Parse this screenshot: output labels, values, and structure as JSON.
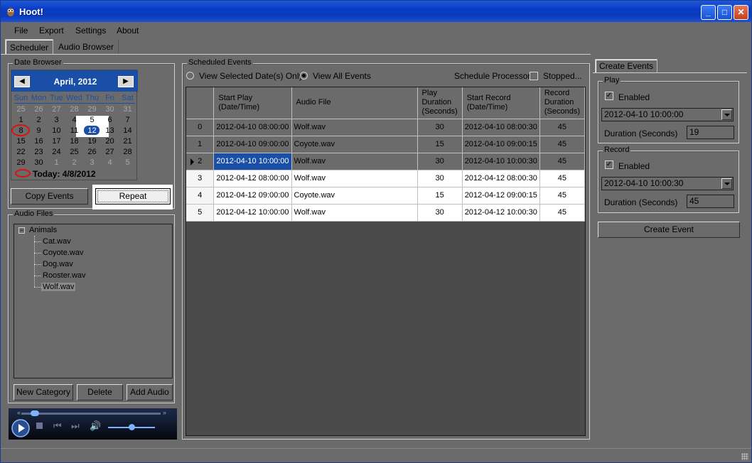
{
  "window": {
    "title": "Hoot!"
  },
  "menu": [
    "File",
    "Export",
    "Settings",
    "About"
  ],
  "tabs": [
    "Scheduler",
    "Audio Browser"
  ],
  "date_browser": {
    "label": "Date Browser",
    "month_title": "April, 2012",
    "days_of_week": [
      "Sun",
      "Mon",
      "Tue",
      "Wed",
      "Thu",
      "Fri",
      "Sat"
    ],
    "weeks": [
      [
        "25",
        "26",
        "27",
        "28",
        "29",
        "30",
        "31"
      ],
      [
        "1",
        "2",
        "3",
        "4",
        "5",
        "6",
        "7"
      ],
      [
        "8",
        "9",
        "10",
        "11",
        "12",
        "13",
        "14"
      ],
      [
        "15",
        "16",
        "17",
        "18",
        "19",
        "20",
        "21"
      ],
      [
        "22",
        "23",
        "24",
        "25",
        "26",
        "27",
        "28"
      ],
      [
        "29",
        "30",
        "1",
        "2",
        "3",
        "4",
        "5"
      ]
    ],
    "today_text": "Today: 4/8/2012"
  },
  "buttons": {
    "copy_events": "Copy Events",
    "repeat": "Repeat",
    "new_category": "New Category",
    "delete": "Delete",
    "add_audio": "Add Audio",
    "create_event": "Create Event"
  },
  "audio_files": {
    "label": "Audio Files",
    "category": "Animals",
    "files": [
      "Cat.wav",
      "Coyote.wav",
      "Dog.wav",
      "Rooster.wav",
      "Wolf.wav"
    ],
    "selected": "Wolf.wav"
  },
  "scheduled": {
    "label": "Scheduled Events",
    "radio_selected_dates": "View Selected Date(s) Only",
    "radio_all_events": "View All Events",
    "schedule_processor": "Schedule Processor",
    "stopped": "Stopped...",
    "columns": [
      "Start Play (Date/Time)",
      "Audio File",
      "Play Duration (Seconds)",
      "Start Record (Date/Time)",
      "Record Duration (Seconds)"
    ],
    "rows": [
      {
        "index": "0",
        "start_play": "2012-04-10 08:00:00",
        "audio": "Wolf.wav",
        "play_dur": "30",
        "start_rec": "2012-04-10 08:00:30",
        "rec_dur": "45"
      },
      {
        "index": "1",
        "start_play": "2012-04-10 09:00:00",
        "audio": "Coyote.wav",
        "play_dur": "15",
        "start_rec": "2012-04-10 09:00:15",
        "rec_dur": "45"
      },
      {
        "index": "2",
        "start_play": "2012-04-10 10:00:00",
        "audio": "Wolf.wav",
        "play_dur": "30",
        "start_rec": "2012-04-10 10:00:30",
        "rec_dur": "45"
      },
      {
        "index": "3",
        "start_play": "2012-04-12 08:00:00",
        "audio": "Wolf.wav",
        "play_dur": "30",
        "start_rec": "2012-04-12 08:00:30",
        "rec_dur": "45"
      },
      {
        "index": "4",
        "start_play": "2012-04-12 09:00:00",
        "audio": "Coyote.wav",
        "play_dur": "15",
        "start_rec": "2012-04-12 09:00:15",
        "rec_dur": "45"
      },
      {
        "index": "5",
        "start_play": "2012-04-12 10:00:00",
        "audio": "Wolf.wav",
        "play_dur": "30",
        "start_rec": "2012-04-12 10:00:30",
        "rec_dur": "45"
      }
    ]
  },
  "create_events": {
    "tab": "Create Events",
    "play": {
      "label": "Play",
      "enabled_label": "Enabled",
      "datetime": "2012-04-10 10:00:00",
      "duration_label": "Duration (Seconds)",
      "duration": "19"
    },
    "record": {
      "label": "Record",
      "enabled_label": "Enabled",
      "datetime": "2012-04-10 10:00:30",
      "duration_label": "Duration (Seconds)",
      "duration": "45"
    }
  },
  "colors": {
    "accent": "#1a4fa8",
    "background": "#6b6b6b",
    "titlebar": "#0a3bc4",
    "today_circle": "#dd1111"
  }
}
